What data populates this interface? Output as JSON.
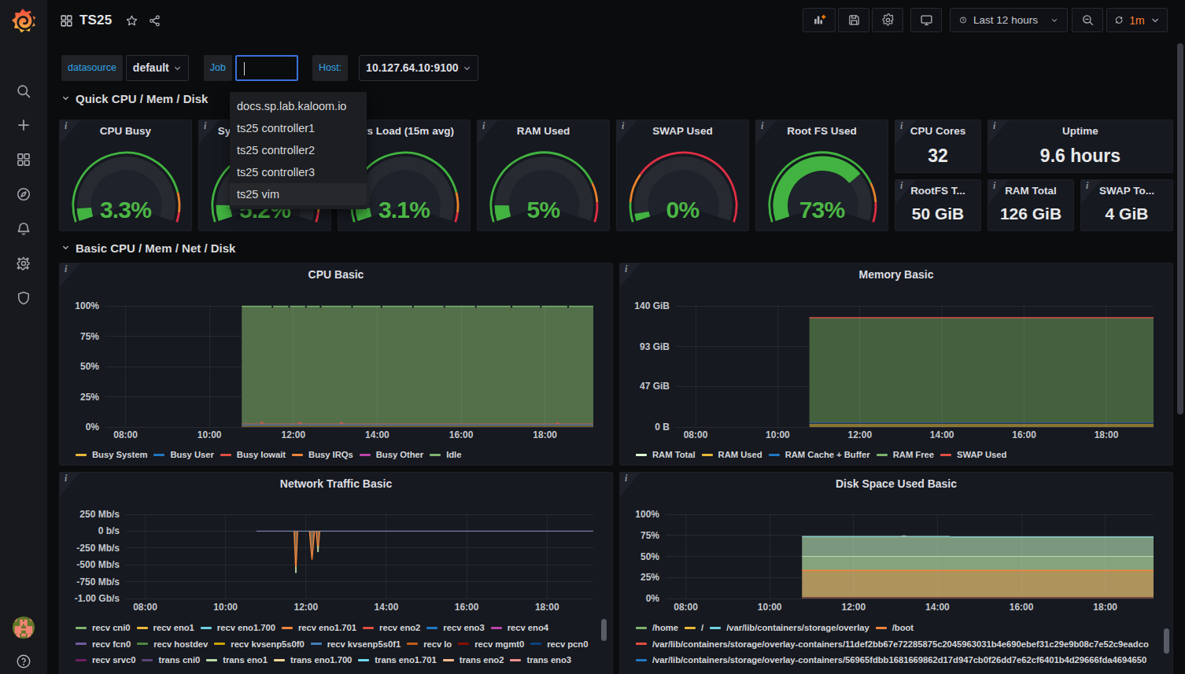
{
  "colors": {
    "accent_blue": "#33a2e5",
    "accent_orange": "#ff8033",
    "gauge_green": "#42b340",
    "gauge_text_green": "#4cb645",
    "threshold_orange": "#e8822c",
    "threshold_red": "#e02f44"
  },
  "sidebar": {
    "icons": [
      "grafana-logo",
      "search",
      "plus",
      "dashboards",
      "explore",
      "alerting",
      "configuration",
      "server-admin"
    ],
    "bottom_icons": [
      "avatar",
      "help"
    ]
  },
  "topbar": {
    "dashboard_title": "TS25",
    "time_range": "Last 12 hours",
    "refresh_interval": "1m"
  },
  "filters": {
    "datasource_label": "datasource",
    "datasource_value": "default",
    "job_label": "Job",
    "job_value": "",
    "host_label": "Host:",
    "host_value": "10.127.64.10:9100",
    "job_options": [
      "docs.sp.lab.kaloom.io",
      "ts25 controller1",
      "ts25 controller2",
      "ts25 controller3",
      "ts25 vim"
    ],
    "job_highlighted": "ts25 vim"
  },
  "sections": [
    {
      "title": "Quick CPU / Mem / Disk"
    },
    {
      "title": "Basic CPU / Mem / Net / Disk"
    }
  ],
  "gauges": [
    {
      "title": "CPU Busy",
      "value_text": "3.3%",
      "percent": 3.3,
      "thresholds": [
        85,
        95
      ]
    },
    {
      "title": "Sys Load (5m avg)",
      "value_text": "5.2%",
      "percent": 5.2,
      "thresholds": [
        85,
        95
      ]
    },
    {
      "title": "Sys Load (15m avg)",
      "value_text": "3.1%",
      "percent": 3.1,
      "thresholds": [
        85,
        95
      ]
    },
    {
      "title": "RAM Used",
      "value_text": "5%",
      "percent": 5,
      "thresholds": [
        80,
        90
      ]
    },
    {
      "title": "SWAP Used",
      "value_text": "0%",
      "percent": 0.4,
      "thresholds": [
        10,
        25
      ]
    },
    {
      "title": "Root FS Used",
      "value_text": "73%",
      "percent": 73,
      "thresholds": [
        80,
        90
      ]
    }
  ],
  "stats": [
    {
      "title": "CPU Cores",
      "value": "32"
    },
    {
      "title": "Uptime",
      "value": "9.6 hours"
    },
    {
      "title": "RootFS T...",
      "value": "50 GiB"
    },
    {
      "title": "RAM Total",
      "value": "126 GiB"
    },
    {
      "title": "SWAP To...",
      "value": "4 GiB"
    }
  ],
  "chart_data": [
    {
      "type": "area",
      "id": "cpu",
      "title": "CPU Basic",
      "x_ticks": [
        "08:00",
        "10:00",
        "12:00",
        "14:00",
        "16:00",
        "18:00"
      ],
      "x_tick_hours": [
        8,
        10,
        12,
        14,
        16,
        18
      ],
      "x_range_hours": [
        7.52,
        19.15
      ],
      "data_start_hour": 10.77,
      "y_ticks": [
        "0%",
        "25%",
        "50%",
        "75%",
        "100%"
      ],
      "y_tick_values": [
        0,
        25,
        50,
        75,
        100
      ],
      "y_range": [
        0,
        100
      ],
      "fills": [
        {
          "name": "idle-fill",
          "from": 0,
          "to": 99.7,
          "color": "#53704b"
        },
        {
          "name": "busy-band",
          "from": 0,
          "to": 1.4,
          "color": "#6d5e33"
        }
      ],
      "lines": [
        {
          "name": "idle-top",
          "at": 99.7,
          "color": "#79b56f",
          "width": 1.6
        },
        {
          "name": "iowait-top",
          "at": 2.6,
          "color": "#c65b50",
          "width": 1.2
        },
        {
          "name": "user-top",
          "at": 1.7,
          "color": "#3d6e9e",
          "width": 1.2
        }
      ],
      "spikes": [
        {
          "x": 11.25,
          "to": 4.2,
          "base": 2.6,
          "color": "#c65b50"
        },
        {
          "x": 12.15,
          "to": 4.0,
          "base": 2.6,
          "color": "#c65b50"
        },
        {
          "x": 13.15,
          "to": 3.8,
          "base": 2.6,
          "color": "#c65b50"
        },
        {
          "x": 18.3,
          "to": 3.4,
          "base": 2.6,
          "color": "#c65b50"
        }
      ],
      "top_notches": [
        11.5,
        11.9,
        12.3,
        12.65,
        13.4,
        14.1,
        14.85,
        15.6,
        16.35,
        17.2,
        17.9,
        18.55
      ],
      "legend_rows": [
        [
          {
            "label": "Busy System",
            "color": "#EAB839"
          },
          {
            "label": "Busy User",
            "color": "#1F78C1"
          },
          {
            "label": "Busy Iowait",
            "color": "#E24D42"
          },
          {
            "label": "Busy IRQs",
            "color": "#EF843C"
          },
          {
            "label": "Busy Other",
            "color": "#BA43A9"
          },
          {
            "label": "Idle",
            "color": "#7EB26D"
          }
        ]
      ]
    },
    {
      "type": "area",
      "id": "mem",
      "title": "Memory Basic",
      "x_ticks": [
        "08:00",
        "10:00",
        "12:00",
        "14:00",
        "16:00",
        "18:00"
      ],
      "x_tick_hours": [
        8,
        10,
        12,
        14,
        16,
        18
      ],
      "x_range_hours": [
        7.52,
        19.15
      ],
      "data_start_hour": 10.77,
      "y_ticks": [
        "0 B",
        "47 GiB",
        "93 GiB",
        "140 GiB"
      ],
      "y_tick_values": [
        0,
        47,
        93,
        140
      ],
      "y_range": [
        0,
        140
      ],
      "fills": [
        {
          "name": "free-fill",
          "from": 5,
          "to": 126.3,
          "color": "#45603d"
        },
        {
          "name": "used-band",
          "from": 0,
          "to": 3.8,
          "color": "#8a7434"
        }
      ],
      "lines": [
        {
          "name": "total-top",
          "at": 126.3,
          "color": "#d4574b",
          "width": 1.4
        },
        {
          "name": "cache-line",
          "at": 5,
          "color": "#2b5d8d",
          "width": 1.5
        }
      ],
      "spikes": [],
      "top_notches": [],
      "legend_rows": [
        [
          {
            "label": "RAM Total",
            "color": "#E0F9D7"
          },
          {
            "label": "RAM Used",
            "color": "#EAB839"
          },
          {
            "label": "RAM Cache + Buffer",
            "color": "#1F78C1"
          },
          {
            "label": "RAM Free",
            "color": "#7EB26D"
          },
          {
            "label": "SWAP Used",
            "color": "#E24D42"
          }
        ]
      ]
    },
    {
      "type": "line",
      "id": "net",
      "title": "Network Traffic Basic",
      "x_ticks": [
        "08:00",
        "10:00",
        "12:00",
        "14:00",
        "16:00",
        "18:00"
      ],
      "x_tick_hours": [
        8,
        10,
        12,
        14,
        16,
        18
      ],
      "x_range_hours": [
        7.52,
        19.15
      ],
      "data_start_hour": 10.77,
      "y_ticks": [
        "250 Mb/s",
        "0 b/s",
        "-250 Mb/s",
        "-500 Mb/s",
        "-750 Mb/s",
        "-1.00 Gb/s"
      ],
      "y_tick_values": [
        250,
        0,
        -250,
        -500,
        -750,
        -1000
      ],
      "y_range": [
        -1000,
        250
      ],
      "fills": [],
      "lines": [
        {
          "name": "zero-line",
          "at": 0,
          "color": "#747fa6",
          "width": 1.4
        }
      ],
      "spikes": [
        {
          "x": 11.75,
          "to": -620,
          "base": 0,
          "color": "#ef843c",
          "fill": "rgba(220,180,120,0.5)",
          "half_width": 2.2,
          "tip_color": "#a8cba0"
        },
        {
          "x": 12.15,
          "to": -425,
          "base": 0,
          "color": "#ef843c",
          "fill": "rgba(220,180,120,0.5)",
          "half_width": 3.2
        },
        {
          "x": 12.3,
          "to": -310,
          "base": 0,
          "color": "#ef843c",
          "fill": "rgba(220,180,120,0.5)",
          "half_width": 2.2,
          "tip_color": "#a8cba0"
        }
      ],
      "top_notches": [],
      "legend_rows": [
        [
          {
            "label": "recv cni0",
            "color": "#7EB26D"
          },
          {
            "label": "recv eno1",
            "color": "#EAB839"
          },
          {
            "label": "recv eno1.700",
            "color": "#6ED0E0"
          },
          {
            "label": "recv eno1.701",
            "color": "#EF843C"
          },
          {
            "label": "recv eno2",
            "color": "#E24D42"
          },
          {
            "label": "recv eno3",
            "color": "#1F78C1"
          },
          {
            "label": "recv eno4",
            "color": "#BA43A9"
          }
        ],
        [
          {
            "label": "recv fcn0",
            "color": "#705DA0"
          },
          {
            "label": "recv hostdev",
            "color": "#508642"
          },
          {
            "label": "recv kvsenp5s0f0",
            "color": "#CCA300"
          },
          {
            "label": "recv kvsenp5s0f1",
            "color": "#447EBC"
          },
          {
            "label": "recv lo",
            "color": "#C15C17"
          },
          {
            "label": "recv mgmt0",
            "color": "#890F02"
          },
          {
            "label": "recv pcn0",
            "color": "#0A437C"
          }
        ],
        [
          {
            "label": "recv srvc0",
            "color": "#6D1F62"
          },
          {
            "label": "trans cni0",
            "color": "#584477"
          },
          {
            "label": "trans eno1",
            "color": "#B7DBAB"
          },
          {
            "label": "trans eno1.700",
            "color": "#F4D598"
          },
          {
            "label": "trans eno1.701",
            "color": "#70DBED"
          },
          {
            "label": "trans eno2",
            "color": "#F9BA8F"
          },
          {
            "label": "trans eno3",
            "color": "#F29191"
          }
        ]
      ]
    },
    {
      "type": "area",
      "id": "disk",
      "title": "Disk Space Used Basic",
      "x_ticks": [
        "08:00",
        "10:00",
        "12:00",
        "14:00",
        "16:00",
        "18:00"
      ],
      "x_tick_hours": [
        8,
        10,
        12,
        14,
        16,
        18
      ],
      "x_range_hours": [
        7.52,
        19.15
      ],
      "data_start_hour": 10.77,
      "y_ticks": [
        "0%",
        "25%",
        "50%",
        "75%",
        "100%"
      ],
      "y_tick_values": [
        0,
        25,
        50,
        75,
        100
      ],
      "y_range": [
        0,
        100
      ],
      "fills": [
        {
          "name": "band-top",
          "from": 50,
          "to": 73.2,
          "color": "#7b987e"
        },
        {
          "name": "band-mid",
          "from": 33.3,
          "to": 50,
          "color": "#83a47d"
        },
        {
          "name": "band-low",
          "from": 0,
          "to": 33.3,
          "color": "#ad935c"
        }
      ],
      "lines": [
        {
          "name": "overlay-top-a",
          "at": 73.5,
          "color": "#8fd2cc",
          "width": 1.5,
          "x_to": 14.3
        },
        {
          "name": "overlay-top-b",
          "at": 73.1,
          "color": "#8fd2cc",
          "width": 1.5,
          "x_from": 14.3
        },
        {
          "name": "home-line",
          "at": 50,
          "color": "#b7dbab",
          "width": 1.2
        },
        {
          "name": "boot-line",
          "at": 33.3,
          "color": "#ef843c",
          "width": 1.6
        },
        {
          "name": "oc-line",
          "at": 1.0,
          "color": "#63313c",
          "width": 1.5
        }
      ],
      "spikes": [
        {
          "x": 13.2,
          "to": 74.6,
          "base": 73.5,
          "color": "#9ab89a",
          "half_width": 4,
          "stroke_width": 1.2
        }
      ],
      "top_notches": [],
      "legend_rows": [
        [
          {
            "label": "/home",
            "color": "#7EB26D"
          },
          {
            "label": "/",
            "color": "#EAB839"
          },
          {
            "label": "/var/lib/containers/storage/overlay",
            "color": "#6ED0E0"
          },
          {
            "label": "/boot",
            "color": "#EF843C"
          }
        ],
        [
          {
            "label": "/var/lib/containers/storage/overlay-containers/11def2bb67e72285875c2045963031b4e690ebef31c29e9b08c7e52c9eadco",
            "color": "#E24D42"
          }
        ],
        [
          {
            "label": "/var/lib/containers/storage/overlay-containers/56965fdbb1681669862d17d947cb0f26dd7e62cf6401b4d29666fda4694650",
            "color": "#1F78C1"
          }
        ]
      ]
    }
  ]
}
